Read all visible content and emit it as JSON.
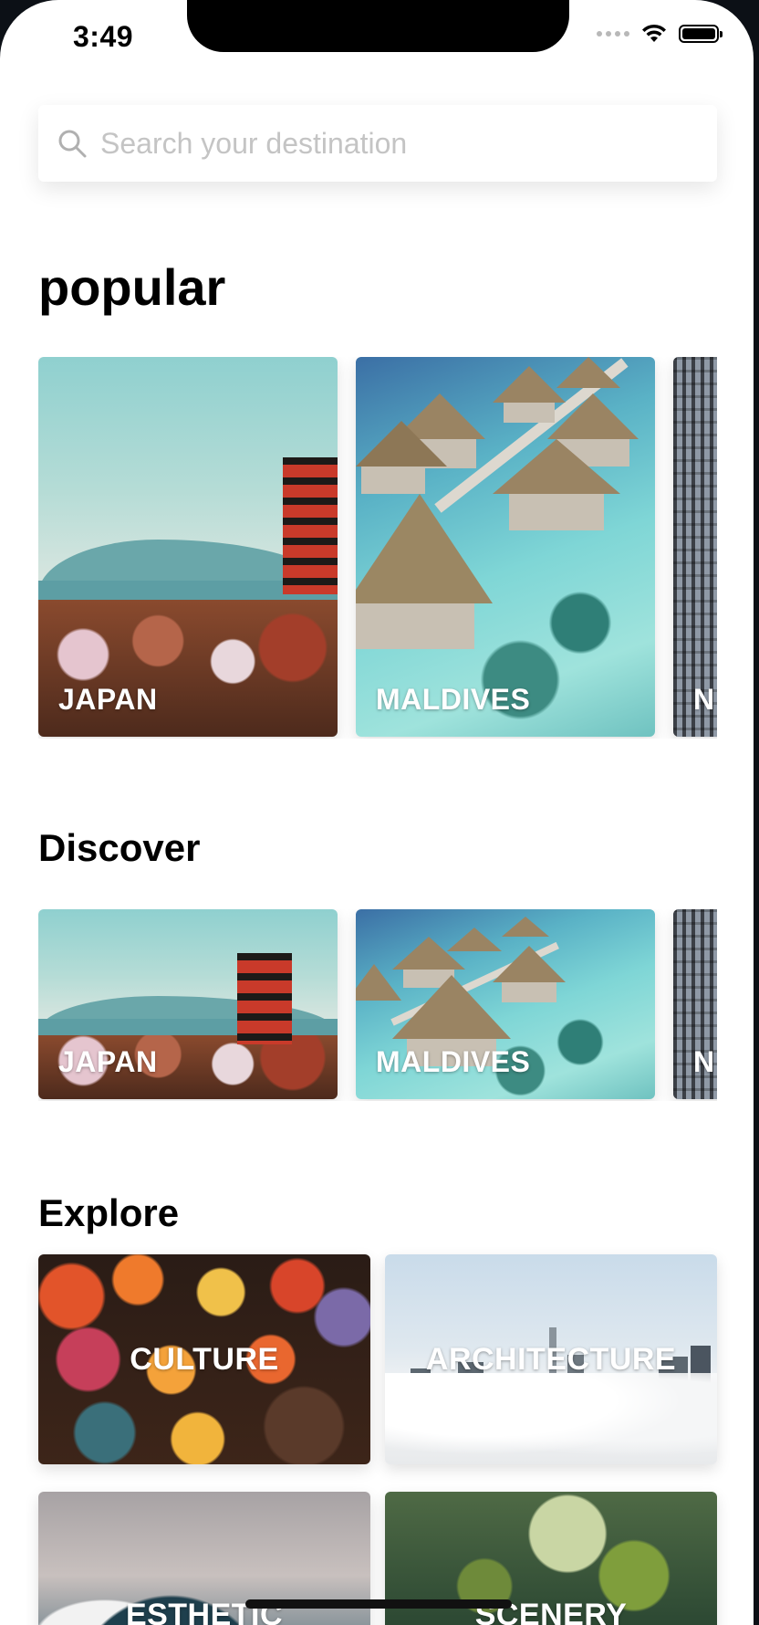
{
  "status_bar": {
    "time": "3:49"
  },
  "search": {
    "placeholder": "Search your destination",
    "icon": "magnifier"
  },
  "sections": {
    "popular": {
      "title": "popular",
      "cards": [
        {
          "label": "JAPAN",
          "image": "pagoda-mountains"
        },
        {
          "label": "MALDIVES",
          "image": "overwater-bungalows"
        },
        {
          "label": "N",
          "image": "city-skyscrapers"
        }
      ]
    },
    "discover": {
      "title": "Discover",
      "cards": [
        {
          "label": "JAPAN",
          "image": "pagoda-mountains"
        },
        {
          "label": "MALDIVES",
          "image": "overwater-bungalows"
        },
        {
          "label": "N",
          "image": "city-skyscrapers"
        }
      ]
    },
    "explore": {
      "title": "Explore",
      "cards": [
        {
          "label": "CULTURE",
          "image": "lanterns-market"
        },
        {
          "label": "ARCHITECTURE",
          "image": "skyline-in-fog"
        },
        {
          "label": "ESTHETIC",
          "image": "ocean-wave"
        },
        {
          "label": "SCENERY",
          "image": "forest-worker"
        }
      ]
    }
  },
  "colors": {
    "background": "#ffffff",
    "text": "#000000",
    "placeholder": "#c4c4c4",
    "card_label": "#ffffff"
  }
}
